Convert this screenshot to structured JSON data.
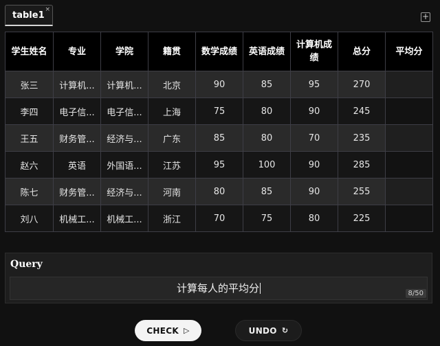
{
  "tabs": [
    {
      "label": "table1",
      "close_glyph": "×"
    }
  ],
  "tab_add_glyph": "+",
  "table": {
    "headers": [
      "学生姓名",
      "专业",
      "学院",
      "籍贯",
      "数学成绩",
      "英语成绩",
      "计算机成绩",
      "总分",
      "平均分"
    ],
    "rows": [
      [
        "张三",
        "计算机...",
        "计算机...",
        "北京",
        "90",
        "85",
        "95",
        "270",
        ""
      ],
      [
        "李四",
        "电子信...",
        "电子信...",
        "上海",
        "75",
        "80",
        "90",
        "245",
        ""
      ],
      [
        "王五",
        "财务管...",
        "经济与...",
        "广东",
        "85",
        "80",
        "70",
        "235",
        ""
      ],
      [
        "赵六",
        "英语",
        "外国语...",
        "江苏",
        "95",
        "100",
        "90",
        "285",
        ""
      ],
      [
        "陈七",
        "财务管...",
        "经济与...",
        "河南",
        "80",
        "85",
        "90",
        "255",
        ""
      ],
      [
        "刘八",
        "机械工...",
        "机械工...",
        "浙江",
        "70",
        "75",
        "80",
        "225",
        ""
      ]
    ]
  },
  "query": {
    "title": "Query",
    "value": "计算每人的平均分",
    "counter": "8/50"
  },
  "buttons": {
    "check_label": "CHECK",
    "check_icon": "▷",
    "undo_label": "UNDO",
    "undo_icon": "↻"
  }
}
